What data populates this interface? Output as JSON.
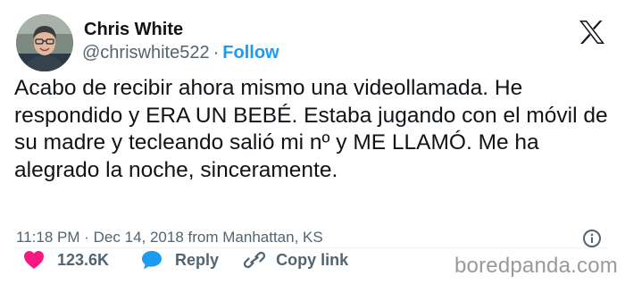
{
  "author": {
    "name": "Chris White",
    "handle": "@chriswhite522",
    "separator": "·",
    "follow_label": "Follow"
  },
  "tweet": {
    "text": "Acabo de recibir ahora mismo una videollamada. He respondido y ERA UN BEBÉ. Estaba jugando con el móvil de su madre y tecleando salió mi nº y ME LLAMÓ. Me ha alegrado la noche, sinceramente.",
    "time": "11:18 PM",
    "date": "Dec 14, 2018",
    "location": "from Manhattan, KS",
    "meta_separator": "·"
  },
  "actions": {
    "likes": "123.6K",
    "reply_label": "Reply",
    "copy_label": "Copy link"
  },
  "watermark": "boredpanda.com",
  "colors": {
    "link": "#1d9bf0",
    "like": "#f91880",
    "text": "#0f1419",
    "muted": "#536471"
  },
  "icons": [
    "x-logo-icon",
    "info-icon",
    "heart-icon",
    "reply-bubble-icon",
    "link-icon"
  ]
}
